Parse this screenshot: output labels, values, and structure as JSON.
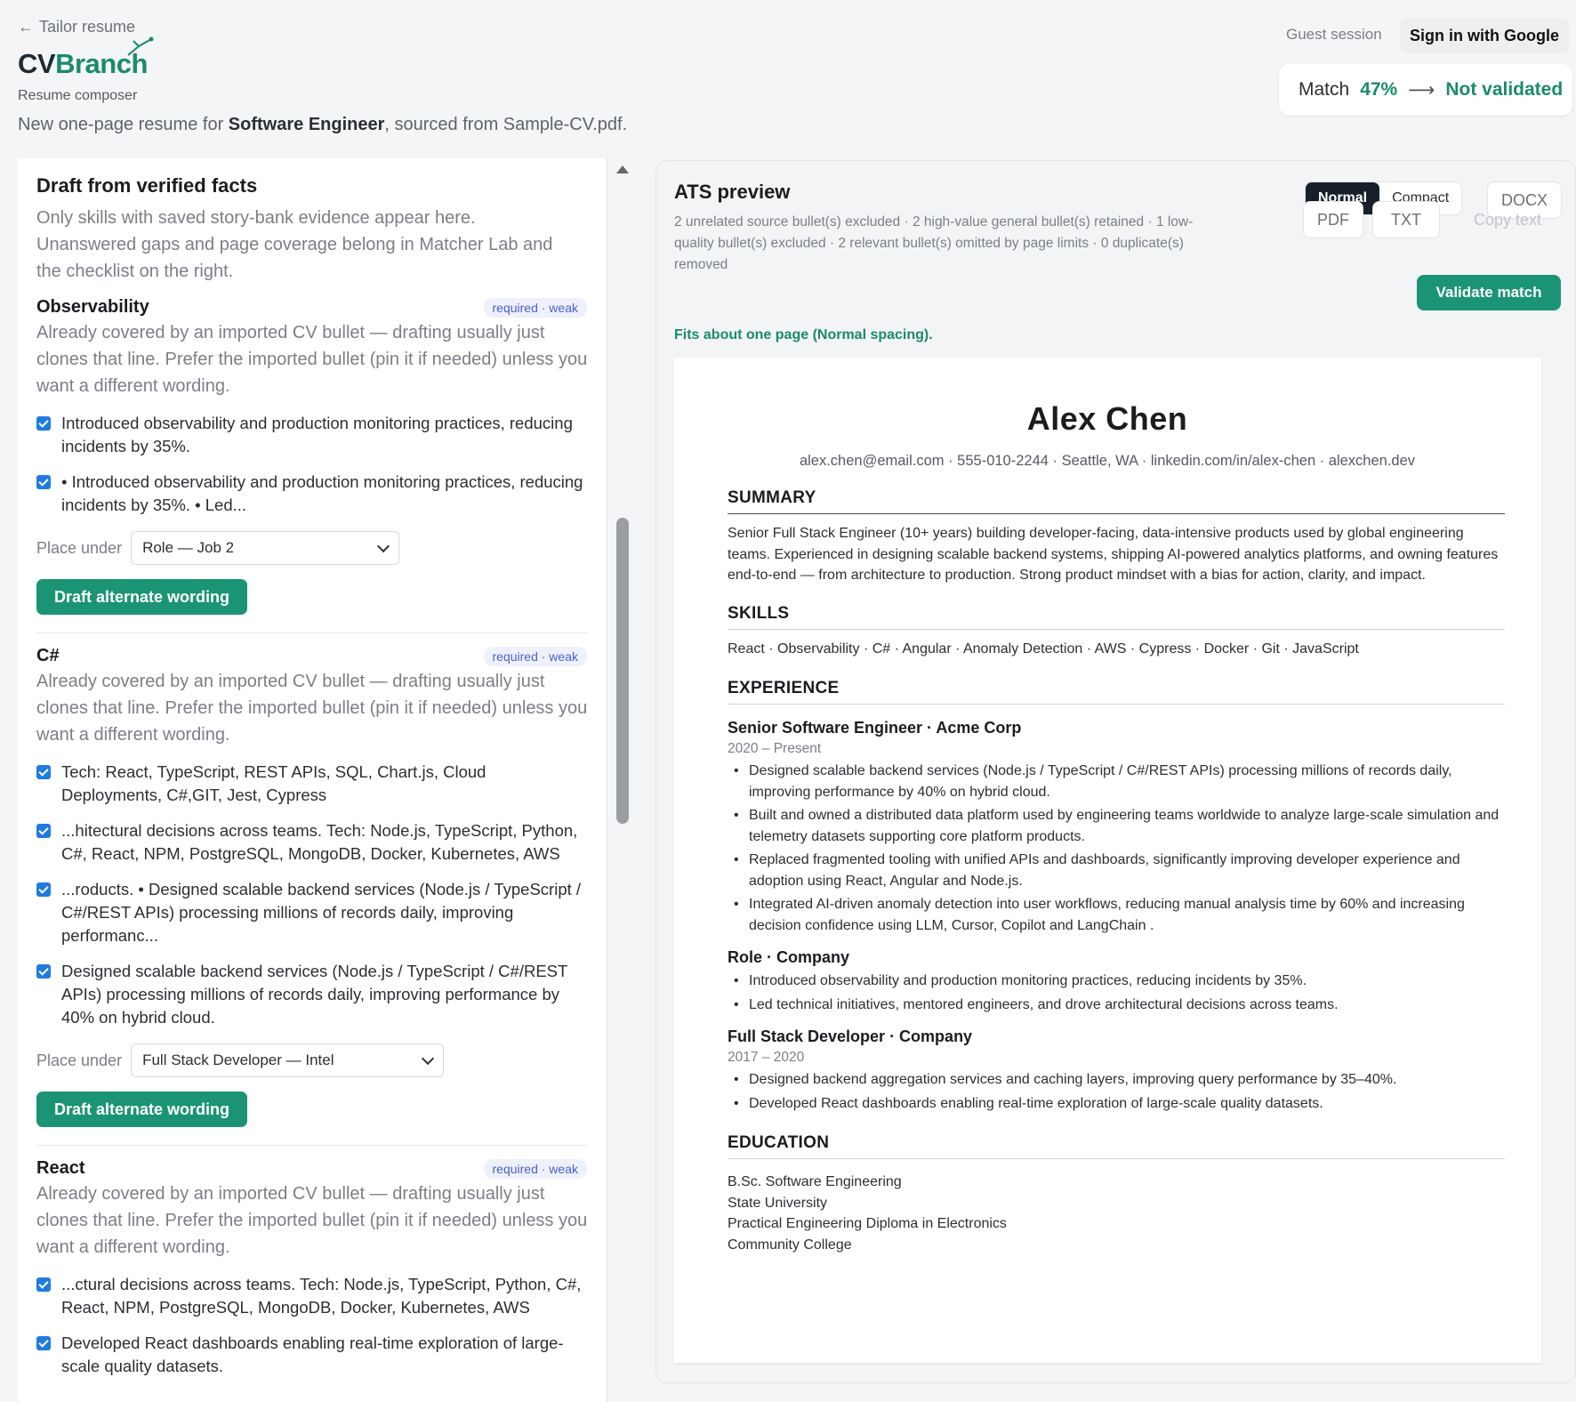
{
  "header": {
    "back_label": "Tailor resume",
    "logo_cv": "CV",
    "logo_branch": "Branch",
    "logo_subtitle": "Resume composer",
    "intro_prefix": "New one-page resume for ",
    "intro_role": "Software Engineer",
    "intro_suffix": ", sourced from Sample-CV.pdf.",
    "guest_label": "Guest session",
    "signin_label": "Sign in with Google",
    "match_label": "Match",
    "match_pct": "47%",
    "match_status": "Not validated"
  },
  "left": {
    "title": "Draft from verified facts",
    "description": "Only skills with saved story-bank evidence appear here. Unanswered gaps and page coverage belong in Matcher Lab and the checklist on the right.",
    "place_under_label": "Place under",
    "draft_button": "Draft alternate wording",
    "facts": [
      {
        "title": "Observability",
        "badge": "required · weak",
        "note": "Already covered by an imported CV bullet — drafting usually just clones that line. Prefer the imported bullet (pin it if needed) unless you want a different wording.",
        "bullets": [
          "Introduced observability and production monitoring practices, reducing incidents by 35%.",
          "• Introduced observability and production monitoring practices, reducing incidents by 35%. • Led..."
        ],
        "place_under": "Role — Job 2"
      },
      {
        "title": "C#",
        "badge": "required · weak",
        "note": "Already covered by an imported CV bullet — drafting usually just clones that line. Prefer the imported bullet (pin it if needed) unless you want a different wording.",
        "bullets": [
          "Tech: React, TypeScript, REST APIs, SQL, Chart.js, Cloud Deployments, C#,GIT, Jest, Cypress",
          "...hitectural decisions across teams. Tech: Node.js, TypeScript, Python, C#, React, NPM, PostgreSQL, MongoDB, Docker, Kubernetes, AWS",
          "...roducts. • Designed scalable backend services (Node.js / TypeScript / C#/REST APIs) processing millions of records daily, improving performanc...",
          "Designed scalable backend services (Node.js / TypeScript / C#/REST APIs) processing millions of records daily, improving performance by 40% on hybrid cloud."
        ],
        "place_under": "Full Stack Developer — Intel"
      },
      {
        "title": "React",
        "badge": "required · weak",
        "note": "Already covered by an imported CV bullet — drafting usually just clones that line. Prefer the imported bullet (pin it if needed) unless you want a different wording.",
        "bullets": [
          "...ctural decisions across teams. Tech: Node.js, TypeScript, Python, C#, React, NPM, PostgreSQL, MongoDB, Docker, Kubernetes, AWS",
          "Developed React dashboards enabling real-time exploration of large-scale quality datasets."
        ]
      }
    ]
  },
  "ats": {
    "title": "ATS preview",
    "stats": "2 unrelated source bullet(s) excluded · 2 high-value general bullet(s) retained · 1 low-quality bullet(s) excluded · 2 relevant bullet(s) omitted by page limits · 0 duplicate(s) removed",
    "mode_normal": "Normal",
    "mode_compact": "Compact",
    "docx": "DOCX",
    "pdf": "PDF",
    "txt": "TXT",
    "copy_text": "Copy text",
    "validate": "Validate match",
    "fits": "Fits about one page (Normal spacing)."
  },
  "resume": {
    "name": "Alex Chen",
    "contact": "alex.chen@email.com · 555-010-2244 · Seattle, WA · linkedin.com/in/alex-chen · alexchen.dev",
    "summary_h": "SUMMARY",
    "summary": "Senior Full Stack Engineer (10+ years) building developer-facing, data-intensive products used by global engineering teams. Experienced in designing scalable backend systems, shipping AI-powered analytics platforms, and owning features end-to-end — from architecture to production. Strong product mindset with a bias for action, clarity, and impact.",
    "skills_h": "SKILLS",
    "skills": "React · Observability · C# · Angular · Anomaly Detection · AWS · Cypress · Docker · Git · JavaScript",
    "experience_h": "EXPERIENCE",
    "jobs": [
      {
        "title": "Senior Software Engineer · Acme Corp",
        "dates": "2020 – Present",
        "bullets": [
          "Designed scalable backend services (Node.js / TypeScript / C#/REST APIs) processing millions of records daily, improving performance by 40% on hybrid cloud.",
          "Built and owned a distributed data platform used by engineering teams worldwide to analyze large-scale simulation and telemetry datasets supporting core platform products.",
          "Replaced fragmented tooling with unified APIs and dashboards, significantly improving developer experience and adoption using React, Angular and Node.js.",
          "Integrated AI-driven anomaly detection into user workflows, reducing manual analysis time by 60% and increasing decision confidence using LLM, Cursor, Copilot and LangChain ."
        ]
      },
      {
        "title": "Role · Company",
        "dates": "",
        "bullets": [
          "Introduced observability and production monitoring practices, reducing incidents by 35%.",
          "Led technical initiatives, mentored engineers, and drove architectural decisions across teams."
        ]
      },
      {
        "title": "Full Stack Developer · Company",
        "dates": "2017 – 2020",
        "bullets": [
          "Designed backend aggregation services and caching layers, improving query performance by 35–40%.",
          "Developed React dashboards enabling real-time exploration of large-scale quality datasets."
        ]
      }
    ],
    "education_h": "EDUCATION",
    "education": [
      "B.Sc. Software Engineering",
      "State University",
      "Practical Engineering Diploma in Electronics",
      "Community College"
    ]
  }
}
